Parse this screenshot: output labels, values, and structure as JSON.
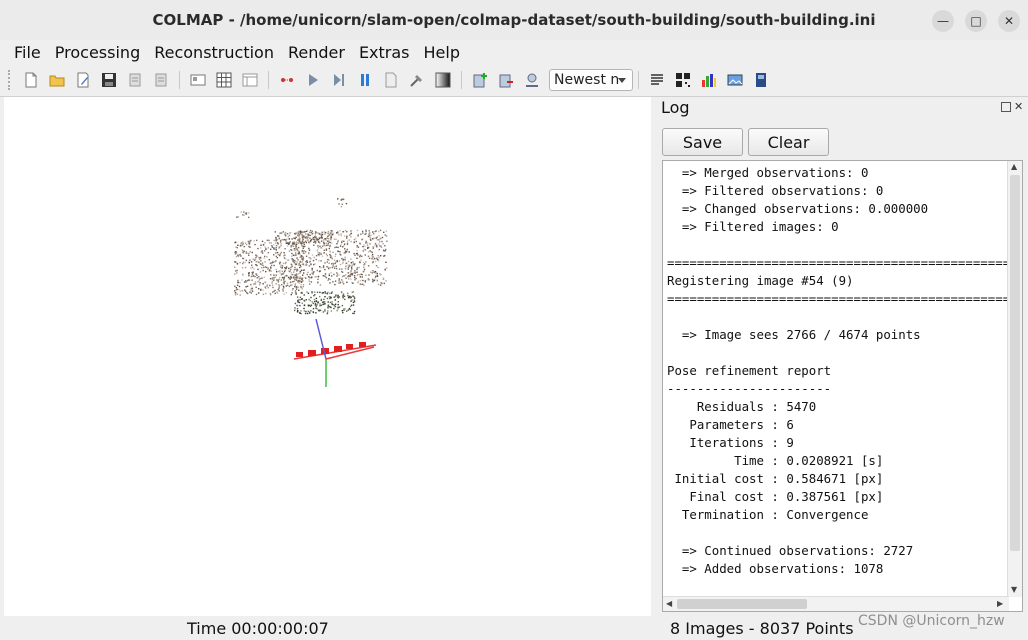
{
  "window": {
    "title": "COLMAP - /home/unicorn/slam-open/colmap-dataset/south-building/south-building.ini"
  },
  "menu": [
    "File",
    "Processing",
    "Reconstruction",
    "Render",
    "Extras",
    "Help"
  ],
  "toolbar": {
    "icons": [
      "new-project-icon",
      "open-project-icon",
      "edit-project-icon",
      "save-project-icon",
      "import-icon",
      "export-icon",
      "feature-extraction-icon",
      "feature-matching-icon",
      "database-icon",
      "automatic-reconstruction-icon",
      "start-reconstruction-icon",
      "step-reconstruction-icon",
      "pause-reconstruction-icon",
      "reset-reconstruction-icon",
      "bundle-adjustment-icon",
      "dense-reconstruction-icon",
      "model-add-icon",
      "model-export-icon",
      "model-location-icon",
      "log-icon",
      "match-matrix-icon",
      "statistics-icon",
      "images-icon",
      "grab-image-icon"
    ],
    "model_select": "Newest n"
  },
  "log": {
    "title": "Log",
    "save_label": "Save",
    "clear_label": "Clear",
    "lines": [
      "  => Merged observations: 0",
      "  => Filtered observations: 0",
      "  => Changed observations: 0.000000",
      "  => Filtered images: 0",
      "",
      "==============================================",
      "Registering image #54 (9)",
      "==============================================",
      "",
      "  => Image sees 2766 / 4674 points",
      "",
      "Pose refinement report",
      "----------------------",
      "    Residuals : 5470",
      "   Parameters : 6",
      "   Iterations : 9",
      "         Time : 0.0208921 [s]",
      " Initial cost : 0.584671 [px]",
      "   Final cost : 0.387561 [px]",
      "  Termination : Convergence",
      "",
      "  => Continued observations: 2727",
      "  => Added observations: 1078"
    ]
  },
  "status": {
    "time": "Time 00:00:00:07",
    "count": "8 Images - 8037 Points"
  },
  "watermark": "CSDN @Unicorn_hzw",
  "colors": {
    "camera": "#e02020",
    "axis_x": "#e83a3a",
    "axis_y": "#3fbf3f",
    "axis_z": "#5a5ad8"
  }
}
